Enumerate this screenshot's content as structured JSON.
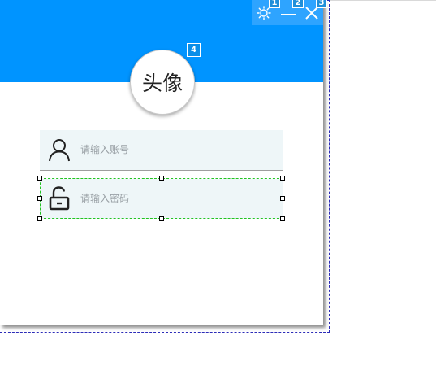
{
  "window": {
    "avatar_text": "头像",
    "controls": {
      "settings_icon": "gear-icon",
      "minimize_icon": "minimize-icon",
      "close_icon": "close-icon"
    },
    "header_color": "#0094ff"
  },
  "designer": {
    "tab_badges": [
      "1",
      "2",
      "3"
    ],
    "avatar_badge": "4"
  },
  "form": {
    "username": {
      "icon": "user-icon",
      "placeholder": "请输入账号",
      "value": ""
    },
    "password": {
      "icon": "unlock-icon",
      "placeholder": "请输入密码",
      "value": ""
    }
  }
}
